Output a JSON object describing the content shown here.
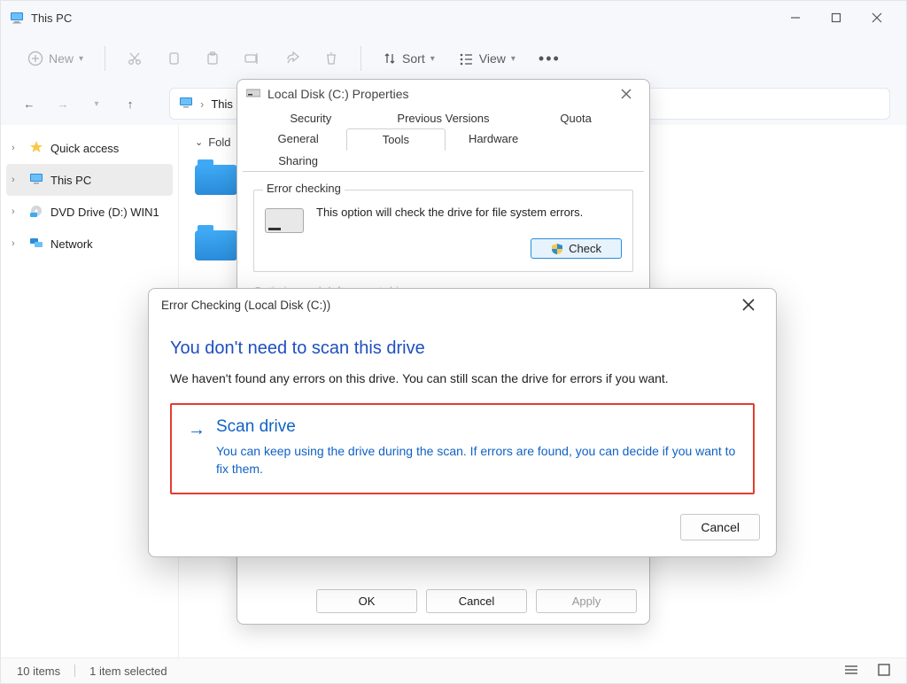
{
  "titlebar": {
    "title": "This PC"
  },
  "toolbar": {
    "new": "New",
    "sort": "Sort",
    "view": "View"
  },
  "nav": {
    "breadcrumb_root": "This"
  },
  "sidebar": {
    "items": [
      {
        "label": "Quick access"
      },
      {
        "label": "This PC"
      },
      {
        "label": "DVD Drive (D:) WIN1"
      },
      {
        "label": "Network"
      }
    ]
  },
  "content": {
    "folders_header": "Fold"
  },
  "statusbar": {
    "count": "10 items",
    "selected": "1 item selected"
  },
  "props": {
    "title": "Local Disk (C:) Properties",
    "tabs_row1": [
      "Security",
      "Previous Versions",
      "Quota"
    ],
    "tabs_row2": [
      "General",
      "Tools",
      "Hardware",
      "Sharing"
    ],
    "group_title": "Error checking",
    "group_text": "This option will check the drive for file system errors.",
    "check_label": "Check",
    "optimize_hint": "Optimize and defragment drive",
    "footer": {
      "ok": "OK",
      "cancel": "Cancel",
      "apply": "Apply"
    }
  },
  "err": {
    "title": "Error Checking (Local Disk (C:))",
    "heading": "You don't need to scan this drive",
    "body": "We haven't found any errors on this drive. You can still scan the drive for errors if you want.",
    "scan_title": "Scan drive",
    "scan_desc": "You can keep using the drive during the scan. If errors are found, you can decide if you want to fix them.",
    "cancel": "Cancel"
  }
}
